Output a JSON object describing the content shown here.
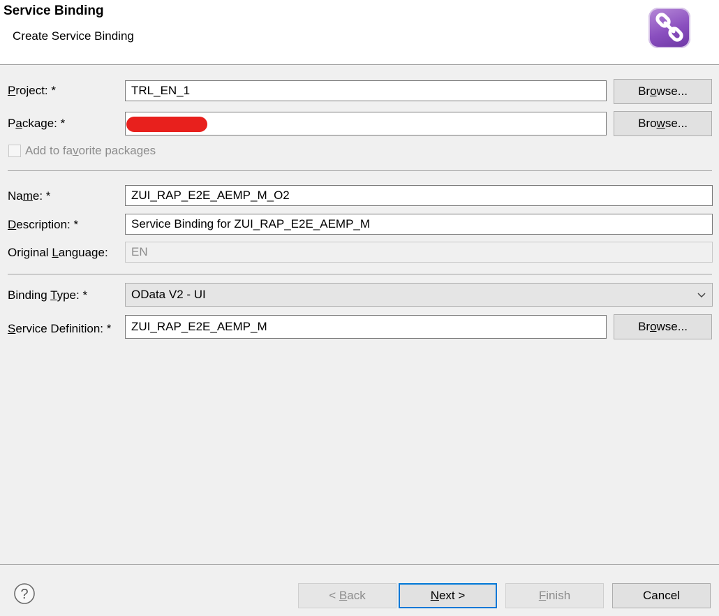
{
  "header": {
    "title": "Service Binding",
    "subtitle": "Create Service Binding",
    "icon": "chain-link-icon"
  },
  "form": {
    "project": {
      "label_pre": "",
      "label_key": "P",
      "label_post": "roject: *",
      "value": "TRL_EN_1",
      "browse_pre": "Br",
      "browse_key": "o",
      "browse_post": "wse..."
    },
    "package": {
      "label_pre": "P",
      "label_key": "a",
      "label_post": "ckage: *",
      "value": "",
      "browse_pre": "Bro",
      "browse_key": "w",
      "browse_post": "se..."
    },
    "favorite": {
      "label_pre": "Add to fa",
      "label_key": "v",
      "label_post": "orite packages",
      "checked": false
    },
    "name": {
      "label_pre": "Na",
      "label_key": "m",
      "label_post": "e: *",
      "value": "ZUI_RAP_E2E_AEMP_M_O2"
    },
    "description": {
      "label_pre": "",
      "label_key": "D",
      "label_post": "escription: *",
      "value": "Service Binding for ZUI_RAP_E2E_AEMP_M"
    },
    "language": {
      "label_pre": "Original ",
      "label_key": "L",
      "label_post": "anguage:",
      "value": "EN"
    },
    "binding_type": {
      "label_pre": "Binding ",
      "label_key": "T",
      "label_post": "ype: *",
      "value": "OData V2 - UI"
    },
    "service_definition": {
      "label_pre": "",
      "label_key": "S",
      "label_post": "ervice Definition: *",
      "value": "ZUI_RAP_E2E_AEMP_M",
      "browse_pre": "Br",
      "browse_key": "o",
      "browse_post": "wse..."
    }
  },
  "footer": {
    "back": {
      "pre": "< ",
      "key": "B",
      "post": "ack"
    },
    "next": {
      "pre": "",
      "key": "N",
      "post": "ext >"
    },
    "finish": {
      "pre": "",
      "key": "F",
      "post": "inish"
    },
    "cancel": "Cancel"
  },
  "colors": {
    "primary_border": "#0078d7",
    "redaction": "#e8201d",
    "icon_purple": "#8a4fbf"
  }
}
